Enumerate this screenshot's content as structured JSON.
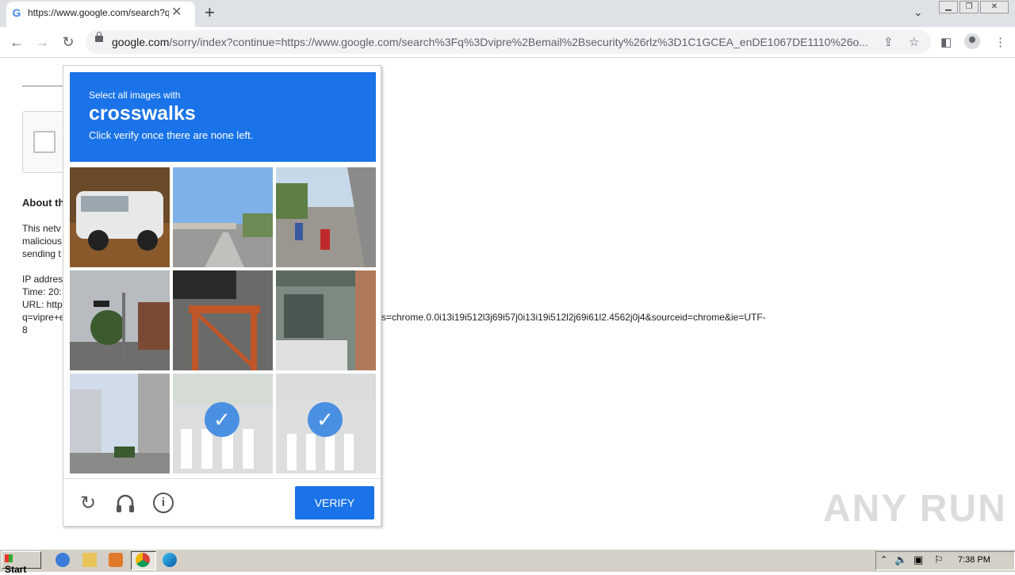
{
  "browser": {
    "tab_title": "https://www.google.com/search?q=",
    "tab_favicon": "G",
    "url_host": "google.com",
    "url_rest": "/sorry/index?continue=https://www.google.com/search%3Fq%3Dvipre%2Bemail%2Bsecurity%26rlz%3D1C1GCEA_enDE1067DE1110%26o..."
  },
  "page": {
    "about_heading": "About th",
    "lines": [
      "This netv",
      "malicious",
      "sending t",
      "IP addres",
      "Time: 20:",
      "URL: http",
      "q=vipre+e",
      "8"
    ],
    "url_tail": "s=chrome.0.0i13i19i512l3j69i57j0i13i19i512l2j69i61l2.4562j0j4&sourceid=chrome&ie=UTF-"
  },
  "captcha": {
    "instruction_small": "Select all images with",
    "target": "crosswalks",
    "instruction_sub": "Click verify once there are none left.",
    "verify_label": "VERIFY",
    "tiles": [
      {
        "scene": "white-suv-parked",
        "selected": false
      },
      {
        "scene": "highway-overpass",
        "selected": false
      },
      {
        "scene": "motorcycles-road",
        "selected": false
      },
      {
        "scene": "street-traffic-light",
        "selected": false
      },
      {
        "scene": "orange-scaffold",
        "selected": false
      },
      {
        "scene": "building-balcony",
        "selected": false
      },
      {
        "scene": "narrow-city-street",
        "selected": false
      },
      {
        "scene": "crosswalk-1",
        "selected": true
      },
      {
        "scene": "crosswalk-2",
        "selected": true
      }
    ]
  },
  "watermark": "ANY RUN",
  "taskbar": {
    "start_label": "Start",
    "clock": "7:38 PM"
  }
}
